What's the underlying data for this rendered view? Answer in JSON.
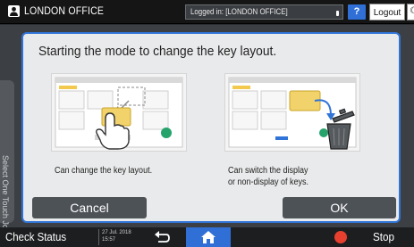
{
  "header": {
    "title": "LONDON OFFICE",
    "login_status": "Logged in: [LONDON OFFICE]",
    "help_label": "?",
    "logout_label": "Logout",
    "user_icon": "user-icon",
    "moon_icon": "moon-icon"
  },
  "background": {
    "side_tab_text": "Select One Touch Job"
  },
  "dialog": {
    "title": "Starting the mode to change the key layout.",
    "captions": [
      "Can change the key layout.",
      "Can switch the display\nor non-display of keys."
    ],
    "cancel_label": "Cancel",
    "ok_label": "OK"
  },
  "footer": {
    "check_status_label": "Check Status",
    "date": "27 Jul. 2018",
    "time": "15:57",
    "back_icon": "back-arrow-icon",
    "home_icon": "home-icon",
    "stop_icon": "stop-icon",
    "stop_label": "Stop"
  },
  "colors": {
    "accent_blue": "#2f6fd6",
    "dialog_border": "#2f74d8",
    "highlight_yellow": "#f2d26a",
    "indicator_green": "#26a36b",
    "stop_red": "#e8402f"
  }
}
